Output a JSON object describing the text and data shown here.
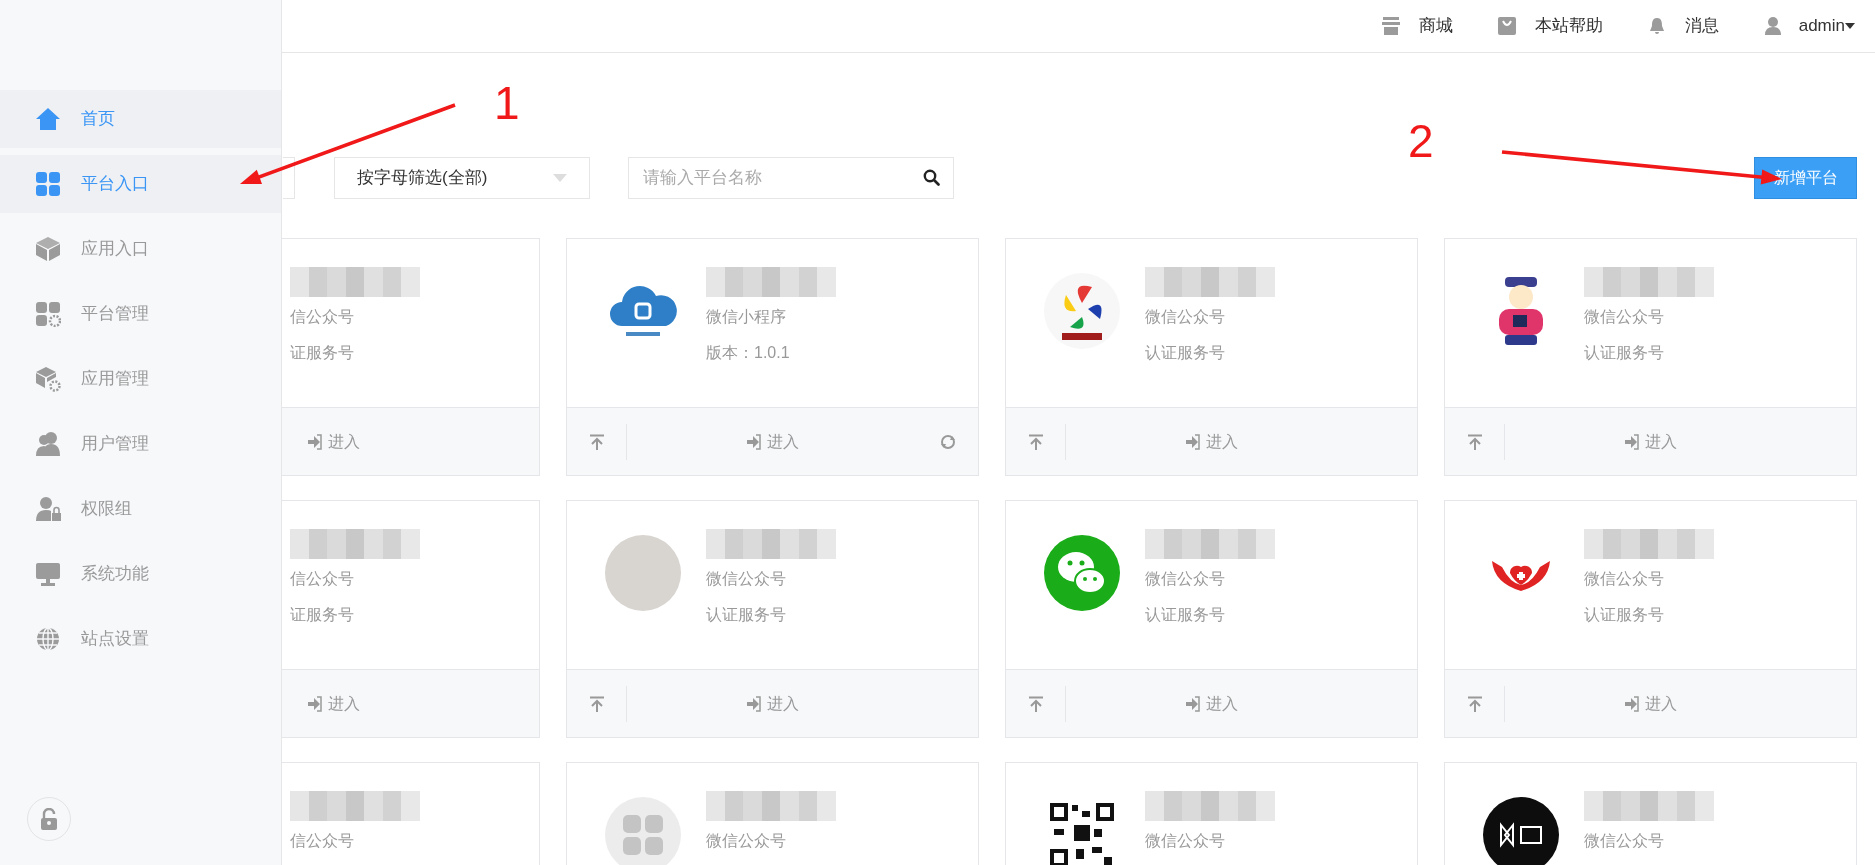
{
  "sidebar": {
    "items": [
      {
        "label": "首页",
        "selected": true
      },
      {
        "label": "平台入口",
        "selected": true
      },
      {
        "label": "应用入口",
        "selected": false
      },
      {
        "label": "平台管理",
        "selected": false
      },
      {
        "label": "应用管理",
        "selected": false
      },
      {
        "label": "用户管理",
        "selected": false
      },
      {
        "label": "权限组",
        "selected": false
      },
      {
        "label": "系统功能",
        "selected": false
      },
      {
        "label": "站点设置",
        "selected": false
      }
    ]
  },
  "topbar": {
    "links": [
      {
        "label": "商城"
      },
      {
        "label": "本站帮助"
      },
      {
        "label": "消息"
      }
    ],
    "user": "admin"
  },
  "filters": {
    "letter_filter": "按字母筛选(全部)",
    "search": {
      "placeholder": "请输入平台名称"
    },
    "add_button": "新增平台"
  },
  "cards": [
    {
      "kind": "covered",
      "name_redacted": true,
      "lines": [
        "信公众号",
        "证服务号"
      ],
      "enter": "进入",
      "pin": false,
      "refresh": false
    },
    {
      "kind": "cloud",
      "name_redacted": true,
      "lines": [
        "微信小程序",
        "版本：1.0.1"
      ],
      "enter": "进入",
      "pin": true,
      "refresh": true
    },
    {
      "kind": "pinwheel",
      "name_redacted": true,
      "lines": [
        "微信公众号",
        "认证服务号"
      ],
      "enter": "进入",
      "pin": true,
      "refresh": false
    },
    {
      "kind": "cartoon",
      "name_redacted": true,
      "lines": [
        "微信公众号",
        "认证服务号"
      ],
      "enter": "进入",
      "pin": true,
      "refresh": false
    },
    {
      "kind": "covered",
      "name_redacted": true,
      "lines": [
        "信公众号",
        "证服务号"
      ],
      "enter": "进入",
      "pin": false,
      "refresh": false
    },
    {
      "kind": "photo",
      "name_redacted": true,
      "lines": [
        "微信公众号",
        "认证服务号"
      ],
      "enter": "进入",
      "pin": true,
      "refresh": false
    },
    {
      "kind": "chat",
      "name_redacted": true,
      "lines": [
        "微信公众号",
        "认证服务号"
      ],
      "enter": "进入",
      "pin": true,
      "refresh": false
    },
    {
      "kind": "hands",
      "name_redacted": true,
      "lines": [
        "微信公众号",
        "认证服务号"
      ],
      "enter": "进入",
      "pin": true,
      "refresh": false
    },
    {
      "kind": "covered",
      "name_redacted": true,
      "lines": [
        "信公众号"
      ],
      "pin": false,
      "refresh": false
    },
    {
      "kind": "default",
      "name_redacted": true,
      "lines": [
        "微信公众号"
      ],
      "pin": false,
      "refresh": false
    },
    {
      "kind": "qr",
      "name_redacted": true,
      "lines": [
        "微信公众号"
      ],
      "pin": false,
      "refresh": false
    },
    {
      "kind": "dark",
      "name_redacted": true,
      "lines": [
        "微信公众号"
      ],
      "pin": false,
      "refresh": false
    }
  ],
  "annotations": [
    {
      "label": "1"
    },
    {
      "label": "2"
    }
  ]
}
